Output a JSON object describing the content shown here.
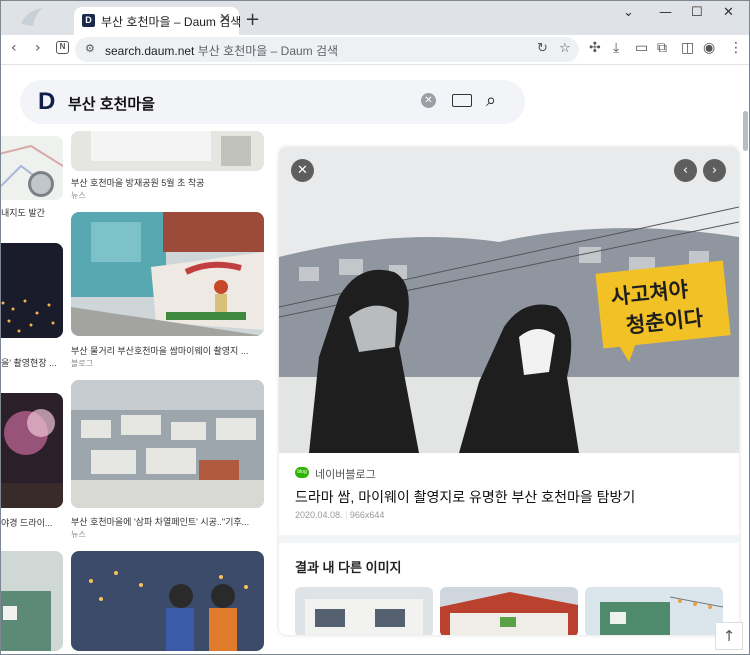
{
  "browser": {
    "tab_title": "부산 호천마을 – Daum 검색",
    "tab_favicon": "D",
    "url_domain": "search.daum.net",
    "url_rest": "부산 호천마을 – Daum 검색"
  },
  "search": {
    "logo": "D",
    "query": "부산 호천마을"
  },
  "results": [
    {
      "caption": "부산 호천마을 방재공원 5월 초 착공",
      "source": "뉴스"
    },
    {
      "caption": "부산 물거리 부산호천마을 쌈마이웨이 촬영지 ...",
      "source": "블로그"
    },
    {
      "caption": "부산 호천마을에 '삼파 차열페인트' 시공..\"기후...",
      "source": "뉴스"
    }
  ],
  "left_column_partial": [
    {
      "caption": "내지도 발간"
    },
    {
      "caption": "을' 촬영현장 ..."
    },
    {
      "caption": "야경 드라이..."
    }
  ],
  "detail": {
    "blog_badge": "blog",
    "blog_name": "네이버블로그",
    "title": "드라마 쌈, 마이웨이 촬영지로 유명한 부산 호천마을 탐방기",
    "date": "2020.04.08.",
    "size": "966x644",
    "mural_text": [
      "사고쳐야",
      "청춘이다"
    ],
    "more_images_title": "결과 내 다른 이미지"
  },
  "colors": {
    "accent_green": "#2db400",
    "daum_navy": "#10204b",
    "tabstrip": "#dfe3e8"
  }
}
